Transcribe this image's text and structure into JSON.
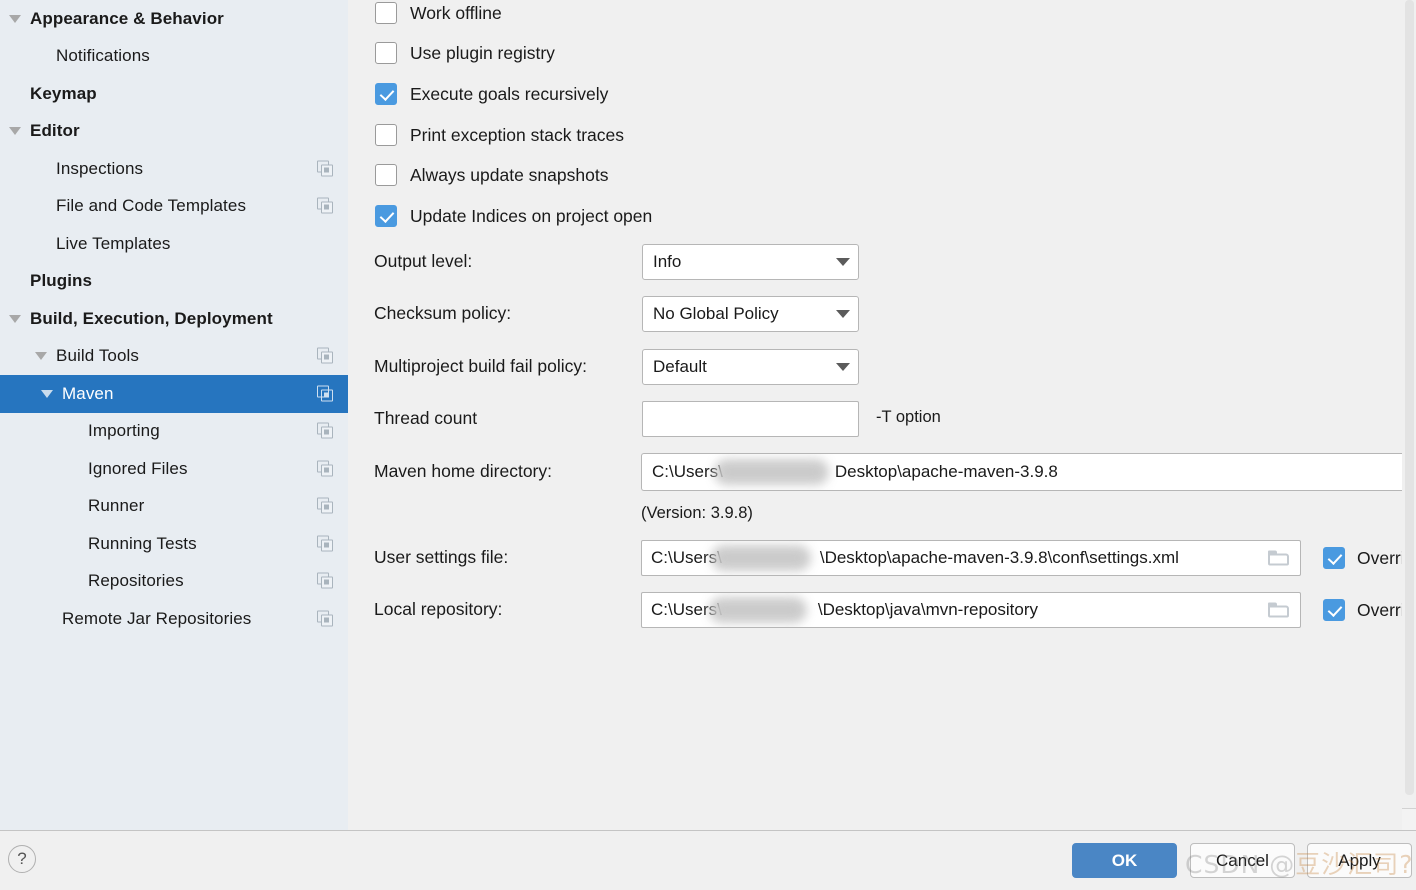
{
  "sidebar": {
    "items": [
      {
        "label": "Appearance & Behavior",
        "indent": 0,
        "bold": true,
        "arrow": "down",
        "copy": false,
        "selected": false
      },
      {
        "label": "Notifications",
        "indent": 1,
        "bold": false,
        "arrow": "none",
        "copy": false,
        "selected": false
      },
      {
        "label": "Keymap",
        "indent": 0,
        "bold": true,
        "arrow": "none",
        "copy": false,
        "selected": false
      },
      {
        "label": "Editor",
        "indent": 0,
        "bold": true,
        "arrow": "down",
        "copy": false,
        "selected": false
      },
      {
        "label": "Inspections",
        "indent": 1,
        "bold": false,
        "arrow": "none",
        "copy": true,
        "selected": false
      },
      {
        "label": "File and Code Templates",
        "indent": 1,
        "bold": false,
        "arrow": "none",
        "copy": true,
        "selected": false
      },
      {
        "label": "Live Templates",
        "indent": 1,
        "bold": false,
        "arrow": "none",
        "copy": false,
        "selected": false
      },
      {
        "label": "Plugins",
        "indent": 0,
        "bold": true,
        "arrow": "none",
        "copy": false,
        "selected": false
      },
      {
        "label": "Build, Execution, Deployment",
        "indent": 0,
        "bold": true,
        "arrow": "down",
        "copy": false,
        "selected": false
      },
      {
        "label": "Build Tools",
        "indent": 1,
        "bold": false,
        "arrow": "down",
        "copy": true,
        "selected": false
      },
      {
        "label": "Maven",
        "indent": 2,
        "bold": false,
        "arrow": "down",
        "copy": true,
        "selected": true
      },
      {
        "label": "Importing",
        "indent": 3,
        "bold": false,
        "arrow": "none",
        "copy": true,
        "selected": false
      },
      {
        "label": "Ignored Files",
        "indent": 3,
        "bold": false,
        "arrow": "none",
        "copy": true,
        "selected": false
      },
      {
        "label": "Runner",
        "indent": 3,
        "bold": false,
        "arrow": "none",
        "copy": true,
        "selected": false
      },
      {
        "label": "Running Tests",
        "indent": 3,
        "bold": false,
        "arrow": "none",
        "copy": true,
        "selected": false
      },
      {
        "label": "Repositories",
        "indent": 3,
        "bold": false,
        "arrow": "none",
        "copy": true,
        "selected": false
      },
      {
        "label": "Remote Jar Repositories",
        "indent": 2,
        "bold": false,
        "arrow": "none",
        "copy": true,
        "selected": false
      }
    ]
  },
  "main": {
    "checkboxes": [
      {
        "label": "Work offline",
        "checked": false
      },
      {
        "label": "Use plugin registry",
        "checked": false
      },
      {
        "label": "Execute goals recursively",
        "checked": true
      },
      {
        "label": "Print exception stack traces",
        "checked": false
      },
      {
        "label": "Always update snapshots",
        "checked": false
      },
      {
        "label": "Update Indices on project open",
        "checked": true
      }
    ],
    "output_level": {
      "label": "Output level:",
      "value": "Info"
    },
    "checksum_policy": {
      "label": "Checksum policy:",
      "value": "No Global Policy"
    },
    "multiproject_policy": {
      "label": "Multiproject build fail policy:",
      "value": "Default"
    },
    "thread_count": {
      "label": "Thread count",
      "value": "",
      "hint": "-T option"
    },
    "maven_home": {
      "label": "Maven home directory:",
      "prefix": "C:\\Users\\",
      "suffix": "Desktop\\apache-maven-3.9.8",
      "ellipsis_button": "..."
    },
    "version_note": "(Version: 3.9.8)",
    "user_settings": {
      "label": "User settings file:",
      "prefix": "C:\\Users\\",
      "suffix": "\\Desktop\\apache-maven-3.9.8\\conf\\settings.xml",
      "override_label": "Override",
      "override_checked": true
    },
    "local_repository": {
      "label": "Local repository:",
      "prefix": "C:\\Users\\",
      "suffix": "\\Desktop\\java\\mvn-repository",
      "override_label": "Override",
      "override_checked": true
    }
  },
  "bottom": {
    "help": "?",
    "ok": "OK",
    "cancel": "Cancel",
    "apply": "Apply"
  },
  "watermark": {
    "prefix": "CSDN @",
    "text": "豆沙汇司?"
  },
  "colors": {
    "selection_blue": "#2675bf",
    "checkbox_blue": "#4a9ae0",
    "ok_button_blue": "#4a86c5",
    "sidebar_bg": "#e8edf2",
    "panel_bg": "#f0f0f0"
  }
}
